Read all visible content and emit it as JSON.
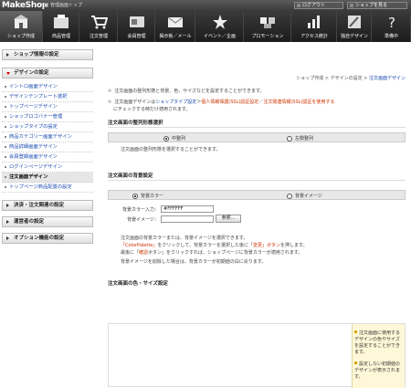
{
  "topbar": {
    "logo": "MakeShop",
    "admin_top": "管理画面トップ",
    "logout": "ログアウト",
    "view_shop": "ショップを見る"
  },
  "nav": [
    {
      "label": "ショップ作成",
      "icon": "shop-create-icon",
      "active": true
    },
    {
      "label": "商品管理",
      "icon": "product-icon"
    },
    {
      "label": "注文管理",
      "icon": "order-icon"
    },
    {
      "label": "会員管理",
      "icon": "member-icon"
    },
    {
      "label": "掲示板／メール",
      "icon": "board-mail-icon"
    },
    {
      "label": "イベント／企画",
      "icon": "event-icon"
    },
    {
      "label": "プロモーション",
      "icon": "promotion-icon"
    },
    {
      "label": "アクセス統計",
      "icon": "stats-icon"
    },
    {
      "label": "独自デザイン",
      "icon": "design-icon"
    },
    {
      "label": "準備中",
      "icon": "help-icon"
    }
  ],
  "sidebar": {
    "sections": [
      {
        "label": "ショップ情報の設定",
        "open": false
      },
      {
        "label": "デザインの設定",
        "open": true
      },
      {
        "label": "決済・注文関連の設定",
        "open": false
      },
      {
        "label": "運営者の設定",
        "open": false
      },
      {
        "label": "オプション機能の設定",
        "open": false
      }
    ],
    "design_items": [
      "イントロ画面デザイン",
      "デザインテンプレート選択",
      "トップページデザイン",
      "ショップロゴバナー管理",
      "ショップタイプの設定",
      "商品カテゴリー画面デザイン",
      "商品詳細画面デザイン",
      "会員登録画面デザイン",
      "ログインページデザイン",
      "注文画面デザイン",
      "トップページ商品配置の設定"
    ]
  },
  "breadcrumb": {
    "part1": "ショップ作成",
    "sep": " > ",
    "part2": "デザインの設定",
    "current": "注文画面デザイン"
  },
  "notes": {
    "note1": "注文画面の整列形態と背景、色、サイズなどを設定することができます。",
    "note2_prefix": "注文画面デザインは",
    "note2_link": "ショップタイプ設定",
    "note2_mid": "＞",
    "note2_red": "個人情報保護(SSL)認証設定",
    "note2_sep": "／",
    "note2_red2": "注文関連情報(SSL)認証を使用する",
    "note2_line2": "にチェックする時だけ適用されます。"
  },
  "layout_section": {
    "title": "注文画面の整列形態選択",
    "opt1": "中整列",
    "opt2": "左側整列",
    "desc": "注文画面の整列形態を選択することができます。"
  },
  "bg_section": {
    "title": "注文画面の背景設定",
    "opt1": "背景カラー",
    "opt2": "背景イメージ",
    "color_label": "背景カラー入力：",
    "color_value": "#FFFFFF",
    "image_label": "背景イメージ：",
    "browse": "参照...",
    "desc1": "注文画面の背景カラーまたは、背景イメージを選択できます。",
    "desc2_link": "「ColorPalette」",
    "desc2": "をクリックして、背景カラーを選択した後に「",
    "desc2_link2": "変更」ボタン",
    "desc2_end": "を押します。",
    "desc3_prefix": "最後に「",
    "desc3_link": "確認",
    "desc3": "ボタン」をクリックすれば、ショップページに背景カラーが適用されます。",
    "desc4": "背景イメージを削除した場合は、背景カラーが初期値の白に戻ります。"
  },
  "color_size_section": {
    "title": "注文画面の色・サイズ設定",
    "side_note1": "注文画面に使用するデザインの色やサイズを設定することができます。",
    "side_note2": "設定しない初期値のデザインが表示されます。"
  }
}
